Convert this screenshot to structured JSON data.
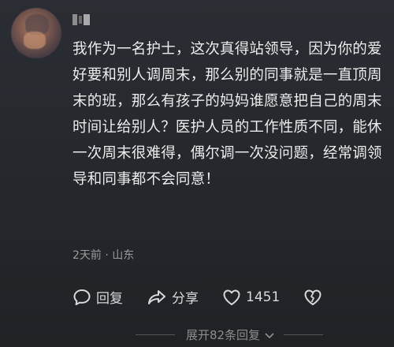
{
  "comment": {
    "body": "我作为一名护士，这次真得站领导，因为你的爱好要和别人调周末，那么别的同事就是一直顶周末的班，那么有孩子的妈妈谁愿意把自己的周末时间让给别人？医护人员的工作性质不同，能休一次周末很难得，偶尔调一次没问题，经常调领导和同事都不会同意！",
    "time": "2天前",
    "separator": "·",
    "location": "山东",
    "reply_label": "回复",
    "share_label": "分享",
    "like_count": "1451"
  },
  "replies": {
    "expand_label": "展开82条回复"
  },
  "icons": {
    "reply": "reply-icon",
    "share": "share-icon",
    "like": "heart-icon",
    "dislike": "broken-heart-icon",
    "expand": "chevron-down-icon"
  }
}
